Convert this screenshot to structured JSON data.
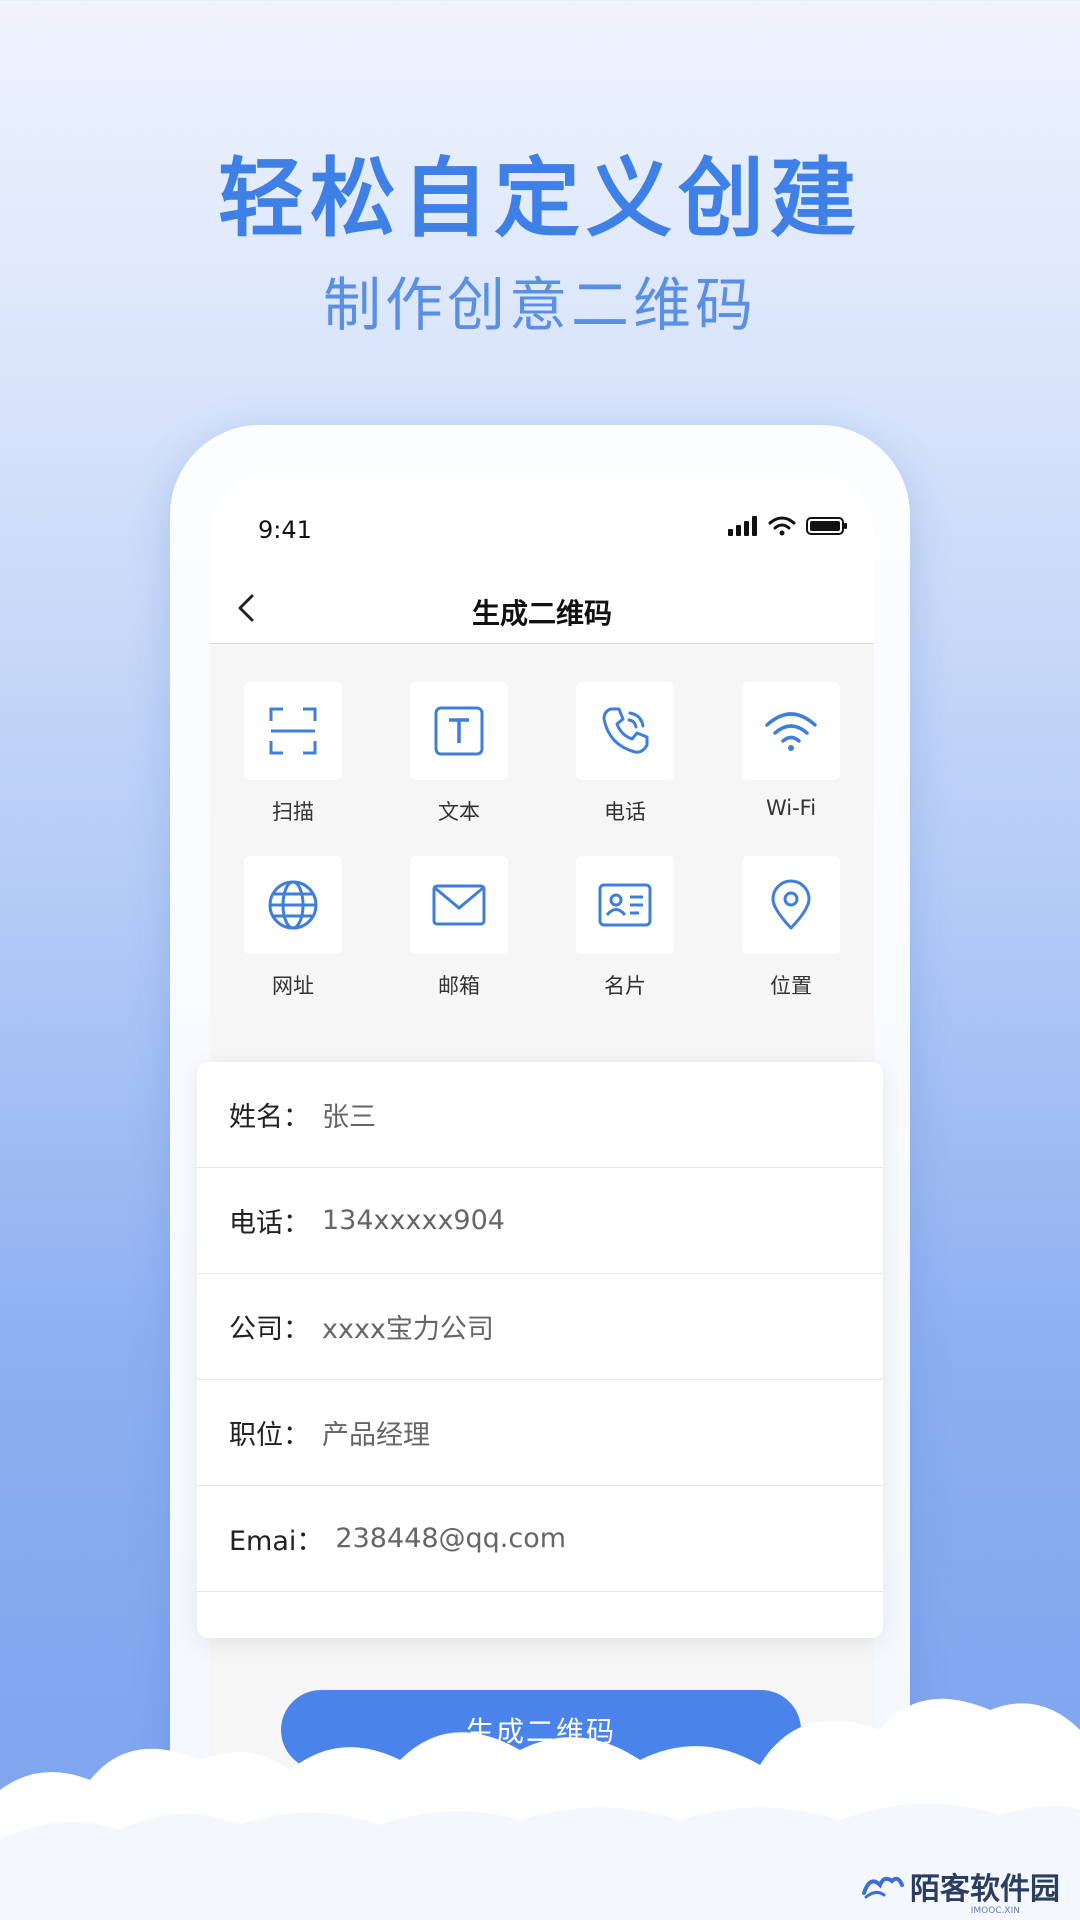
{
  "hero": {
    "title": "轻松自定义创建",
    "subtitle": "制作创意二维码"
  },
  "status_bar": {
    "time": "9:41"
  },
  "nav": {
    "title": "生成二维码"
  },
  "grid": {
    "items": [
      {
        "label": "扫描",
        "icon": "scan-icon"
      },
      {
        "label": "文本",
        "icon": "text-icon"
      },
      {
        "label": "电话",
        "icon": "phone-icon"
      },
      {
        "label": "Wi-Fi",
        "icon": "wifi-icon"
      },
      {
        "label": "网址",
        "icon": "globe-icon"
      },
      {
        "label": "邮箱",
        "icon": "mail-icon"
      },
      {
        "label": "名片",
        "icon": "business-card-icon"
      },
      {
        "label": "位置",
        "icon": "location-icon"
      }
    ]
  },
  "form": {
    "rows": [
      {
        "label": "姓名：",
        "value": "张三"
      },
      {
        "label": "电话：",
        "value": "134xxxxx904"
      },
      {
        "label": "公司：",
        "value": "xxxx宝力公司"
      },
      {
        "label": "职位：",
        "value": "产品经理"
      },
      {
        "label": "Emai：",
        "value": "238448@qq.com"
      }
    ]
  },
  "generate_button": {
    "label": "生成二维码"
  },
  "watermark": {
    "name": "陌客软件园",
    "sub": "IMOOC.XIN"
  },
  "colors": {
    "accent": "#4a83ea",
    "icon": "#3f7fd9",
    "title": "#3f80e6"
  }
}
